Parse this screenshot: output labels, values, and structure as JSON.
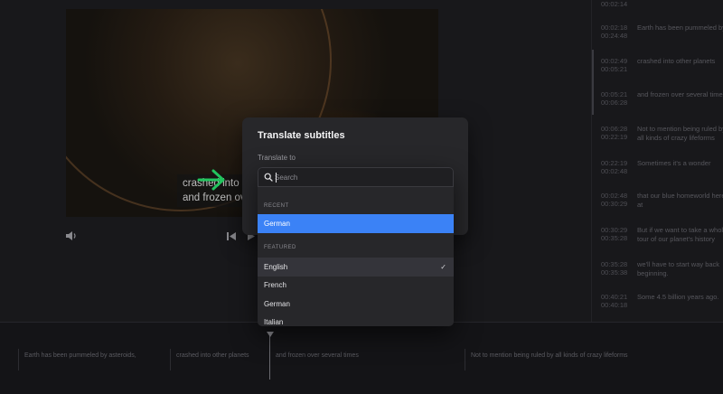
{
  "video": {
    "caption_line1": "crashed into",
    "caption_line2": "and frozen ov"
  },
  "controls": {
    "volume_icon": "speaker-icon",
    "prev_icon": "skip-back-icon",
    "play_icon": "play-icon"
  },
  "transcript": [
    {
      "time": "00:02:14",
      "text": ""
    },
    {
      "time": "00:02:18\n00:24:48",
      "text": "Earth has been pummeled by"
    },
    {
      "time": "00:02:49\n00:05:21",
      "text": "crashed into other planets"
    },
    {
      "time": "00:05:21\n00:06:28",
      "text": "and frozen over several times"
    },
    {
      "time": "00:06:28\n00:22:19",
      "text": "Not to mention being ruled by\nall kinds of crazy lifeforms"
    },
    {
      "time": "00:22:19\n00:02:48",
      "text": "Sometimes it's a wonder"
    },
    {
      "time": "00:02:48\n00:30:29",
      "text": "that our blue homeworld here\nat"
    },
    {
      "time": "00:30:29\n00:35:28",
      "text": "But if we want to take a whol\ntour of our planet's history"
    },
    {
      "time": "00:35:28\n00:35:38",
      "text": "we'll have to start way back\nbeginning."
    },
    {
      "time": "00:40:21\n00:40:18",
      "text": "Some 4.5 billion years ago."
    }
  ],
  "timeline": {
    "segments": [
      "Earth has been pummeled by asteroids,",
      "crashed into other planets",
      "and frozen over several times",
      "Not to mention being ruled by all kinds of crazy lifeforms"
    ]
  },
  "dialog": {
    "title": "Translate subtitles",
    "label": "Translate to"
  },
  "dropdown": {
    "search_placeholder": "Search",
    "recent_label": "RECENT",
    "recent": [
      "German"
    ],
    "featured_label": "FEATURED",
    "featured": [
      "English",
      "French",
      "German",
      "Italian"
    ],
    "checked": "English",
    "check_glyph": "✓"
  },
  "colors": {
    "accent": "#3b82f6",
    "arrow": "#22c55e"
  }
}
